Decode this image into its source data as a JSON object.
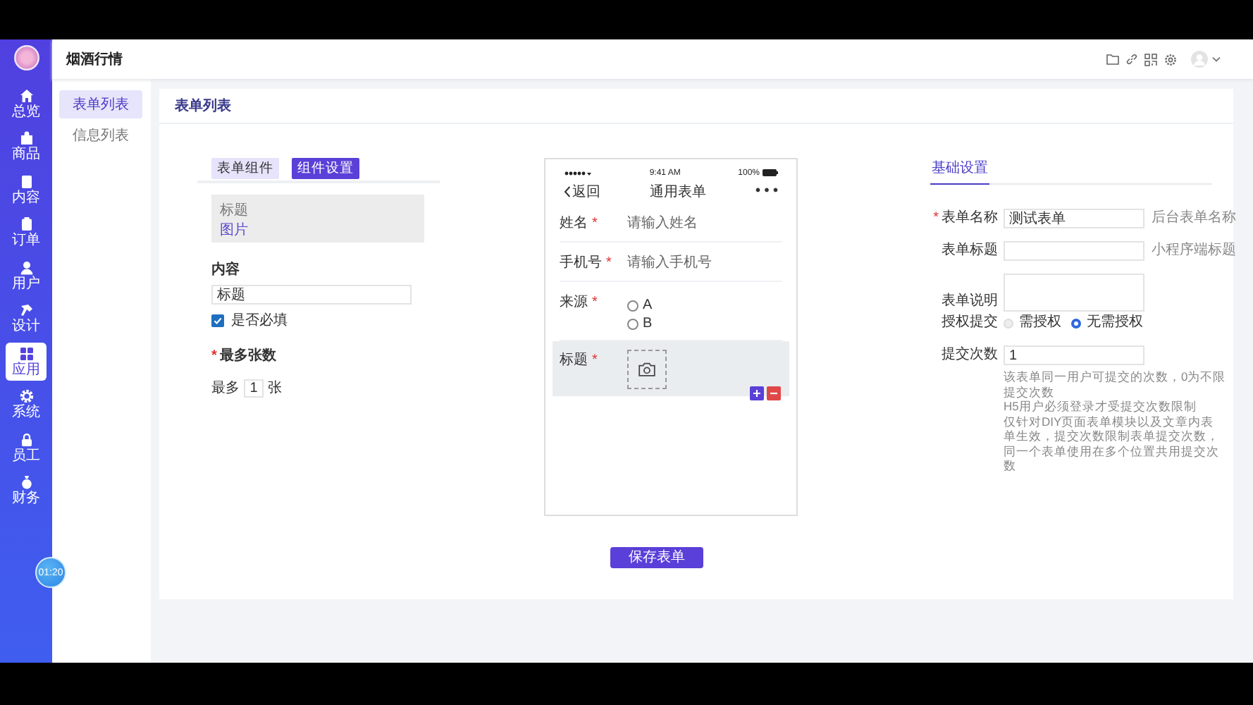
{
  "header": {
    "title": "烟酒行情"
  },
  "sidebar": {
    "items": [
      {
        "label": "总览",
        "selected": false
      },
      {
        "label": "商品",
        "selected": false
      },
      {
        "label": "内容",
        "selected": false
      },
      {
        "label": "订单",
        "selected": false
      },
      {
        "label": "用户",
        "selected": false
      },
      {
        "label": "设计",
        "selected": false
      },
      {
        "label": "应用",
        "selected": true
      },
      {
        "label": "系统",
        "selected": false
      },
      {
        "label": "员工",
        "selected": false
      },
      {
        "label": "财务",
        "selected": false
      }
    ]
  },
  "timer": "01:20",
  "submenu": [
    {
      "label": "表单列表",
      "selected": true
    },
    {
      "label": "信息列表",
      "selected": false
    }
  ],
  "page_title": "表单列表",
  "editor": {
    "tabs": [
      {
        "label": "表单组件",
        "selected": false
      },
      {
        "label": "组件设置",
        "selected": true
      }
    ],
    "component": {
      "title": "标题",
      "type": "图片"
    },
    "content_label": "内容",
    "content_value": "标题",
    "required": {
      "label": "是否必填",
      "checked": true
    },
    "max_mark": "*",
    "max_label": "最多张数",
    "max_prefix": "最多",
    "max_value": "1",
    "max_suffix": "张"
  },
  "phone": {
    "time": "9:41 AM",
    "battery": "100%",
    "back": "返回",
    "title": "通用表单",
    "more": "• • •",
    "fields": [
      {
        "kind": "text",
        "label": "姓名",
        "mark": "*",
        "placeholder": "请输入姓名"
      },
      {
        "kind": "text",
        "label": "手机号",
        "mark": "*",
        "placeholder": "请输入手机号"
      },
      {
        "kind": "radio",
        "label": "来源",
        "mark": "*",
        "options": [
          {
            "label": "A",
            "selected": false
          },
          {
            "label": "B",
            "selected": false
          }
        ]
      },
      {
        "kind": "image",
        "label": "标题",
        "mark": "*",
        "selected": true
      }
    ]
  },
  "settings": {
    "title": "基础设置",
    "fields": [
      {
        "kind": "input",
        "mark": "*",
        "label": "表单名称",
        "value": "测试表单",
        "hint": "后台表单名称"
      },
      {
        "kind": "input",
        "label": "表单标题",
        "hint": "小程序端标题"
      },
      {
        "kind": "textarea",
        "label": "表单说明"
      },
      {
        "kind": "radio",
        "label": "授权提交",
        "options": [
          {
            "label": "需授权",
            "selected": false
          },
          {
            "label": "无需授权",
            "selected": true
          }
        ]
      },
      {
        "kind": "input",
        "label": "提交次数",
        "value": "1",
        "notes": [
          "该表单同一用户可提交的次数，0为不限提交次数",
          "H5用户必须登录才受提交次数限制",
          "仅针对DIY页面表单模块以及文章内表单生效，提交次数限制表单提交次数，同一个表单使用在多个位置共用提交次数"
        ]
      }
    ]
  },
  "save_button": "保存表单"
}
